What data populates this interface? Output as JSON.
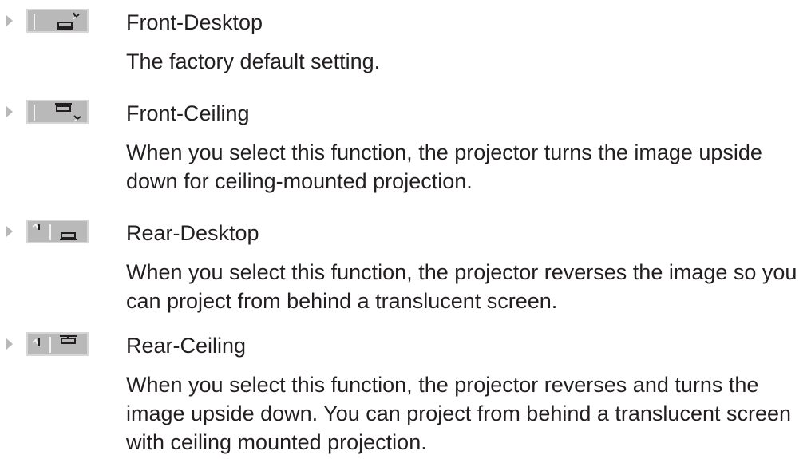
{
  "modes": [
    {
      "icon": "front-desktop-icon",
      "title": "Front-Desktop",
      "description": "The factory default setting."
    },
    {
      "icon": "front-ceiling-icon",
      "title": "Front-Ceiling",
      "description": "When you select this function, the projector turns the image upside down for ceiling-mounted projection."
    },
    {
      "icon": "rear-desktop-icon",
      "title": "Rear-Desktop",
      "description": "When you select this function, the projector reverses the image so you can project from behind a translucent screen."
    },
    {
      "icon": "rear-ceiling-icon",
      "title": "Rear-Ceiling",
      "description": "When you select this function, the projector reverses and turns the image upside down. You can project from behind a translucent screen with ceiling mounted projection."
    }
  ]
}
